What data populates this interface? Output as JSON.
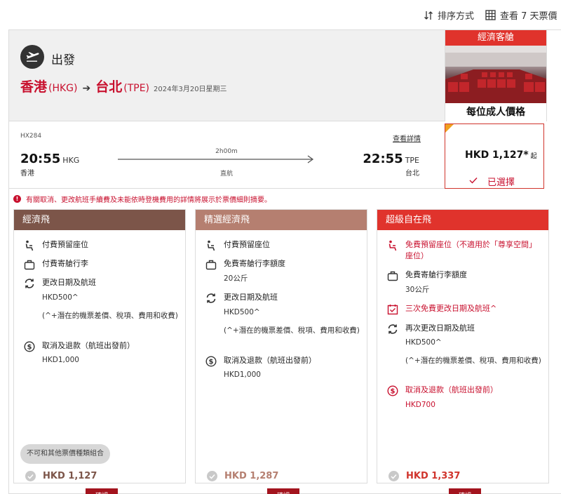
{
  "toolbar": {
    "sort_label": "排序方式",
    "week_label": "查看 7 天票價"
  },
  "departure": {
    "label": "出發",
    "origin_city": "香港",
    "origin_code": "(HKG)",
    "dest_city": "台北",
    "dest_code": "(TPE)",
    "date": "2024年3月20日星期三"
  },
  "cabin": {
    "title": "經濟客艙",
    "price_label": "每位成人價格"
  },
  "flight": {
    "number": "HX284",
    "details_link": "查看詳情",
    "dep_time": "20:55",
    "dep_code": "HKG",
    "dep_city": "香港",
    "arr_time": "22:55",
    "arr_code": "TPE",
    "arr_city": "台北",
    "duration": "2h00m",
    "stops": "直航"
  },
  "selected_price": {
    "amount": "HKD 1,127*",
    "qualifier": "起",
    "status": "已選擇"
  },
  "notice": "有關取消、更改航班手續費及未能依時登機費用的詳情將展示於票價細則摘要。",
  "fares": [
    {
      "name": "經濟飛",
      "seat": "付費預留座位",
      "baggage": "付費寄艙行李",
      "change_title": "更改日期及航班",
      "change_fee": "HKD500^",
      "change_note": "(^+潛在的機票差價、稅項、費用和收費)",
      "refund_title": "取消及退款（航班出發前）",
      "refund_fee": "HKD1,000",
      "combo_note": "不可和其他票價種類組合",
      "price": "HKD 1,127",
      "confirm": "確認"
    },
    {
      "name": "精選經濟飛",
      "seat": "付費預留座位",
      "baggage": "免費寄艙行李額度",
      "baggage_weight": "20公斤",
      "change_title": "更改日期及航班",
      "change_fee": "HKD500^",
      "change_note": "(^+潛在的機票差價、稅項、費用和收費)",
      "refund_title": "取消及退款（航班出發前）",
      "refund_fee": "HKD1,000",
      "price": "HKD 1,287",
      "confirm": "確認"
    },
    {
      "name": "超級自在飛",
      "seat": "免費預留座位（不適用於「尊享空間」座位）",
      "baggage": "免費寄艙行李額度",
      "baggage_weight": "30公斤",
      "free_change": "三次免費更改日期及航班^",
      "change_title": "再次更改日期及航班",
      "change_fee": "HKD500^",
      "change_note": "(^+潛在的機票差價、稅項、費用和收費)",
      "refund_title": "取消及退款（航班出發前）",
      "refund_fee": "HKD700",
      "price": "HKD 1,337",
      "confirm": "確認"
    }
  ],
  "colors": {
    "brand_red": "#c8102e",
    "fare1": "#7c5549",
    "fare2": "#b57f70",
    "fare3": "#e0332c",
    "confirm": "#a3141e"
  }
}
